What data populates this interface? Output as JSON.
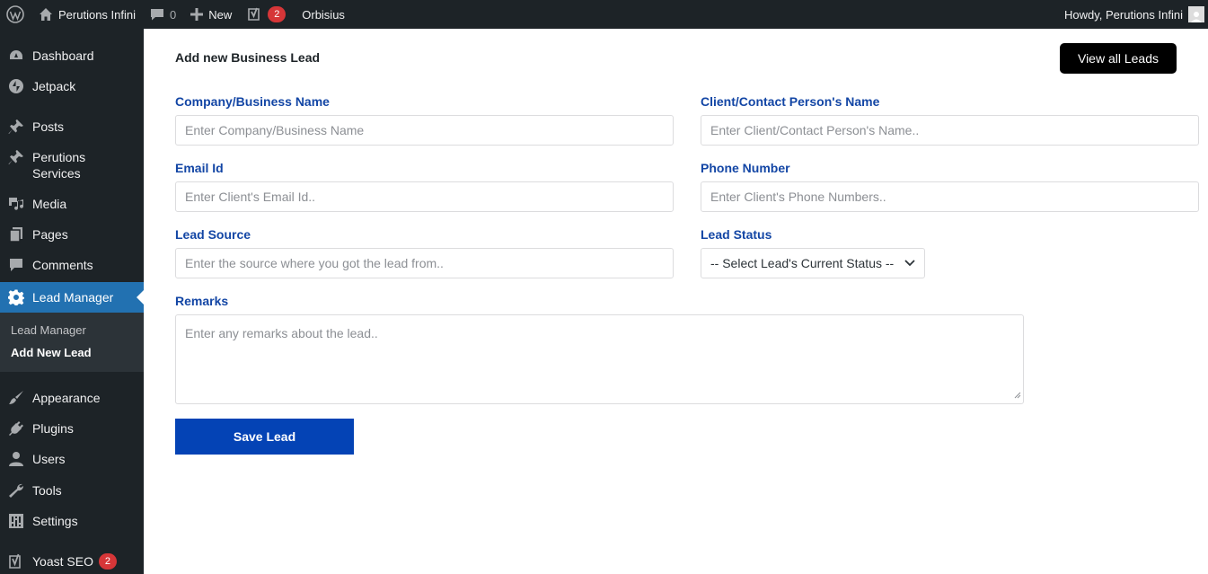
{
  "adminbar": {
    "site_name": "Perutions Infini",
    "comments_count": "0",
    "new_label": "New",
    "yoast_badge": "2",
    "site_link": "Orbisius",
    "howdy": "Howdy, Perutions Infini"
  },
  "sidebar": {
    "items": [
      {
        "label": "Dashboard",
        "icon": "dashboard-icon"
      },
      {
        "label": "Jetpack",
        "icon": "jetpack-icon"
      },
      {
        "label": "Posts",
        "icon": "pin-icon"
      },
      {
        "label": "Perutions Services",
        "icon": "pin-icon"
      },
      {
        "label": "Media",
        "icon": "media-icon"
      },
      {
        "label": "Pages",
        "icon": "pages-icon"
      },
      {
        "label": "Comments",
        "icon": "comment-icon"
      },
      {
        "label": "Lead Manager",
        "icon": "gear-icon"
      },
      {
        "label": "Appearance",
        "icon": "brush-icon"
      },
      {
        "label": "Plugins",
        "icon": "plugin-icon"
      },
      {
        "label": "Users",
        "icon": "user-icon"
      },
      {
        "label": "Tools",
        "icon": "wrench-icon"
      },
      {
        "label": "Settings",
        "icon": "settings-icon"
      },
      {
        "label": "Yoast SEO",
        "icon": "yoast-icon",
        "badge": "2"
      }
    ],
    "submenu": [
      "Lead Manager",
      "Add New Lead"
    ]
  },
  "main": {
    "title": "Add new Business Lead",
    "view_all": "View all Leads",
    "fields": {
      "company": {
        "label": "Company/Business Name",
        "placeholder": "Enter Company/Business Name"
      },
      "client": {
        "label": "Client/Contact Person's Name",
        "placeholder": "Enter Client/Contact Person's Name.."
      },
      "email": {
        "label": "Email Id",
        "placeholder": "Enter Client's Email Id.."
      },
      "phone": {
        "label": "Phone Number",
        "placeholder": "Enter Client's Phone Numbers.."
      },
      "source": {
        "label": "Lead Source",
        "placeholder": "Enter the source where you got the lead from.."
      },
      "status": {
        "label": "Lead Status",
        "selected": "-- Select Lead's Current Status --"
      },
      "remarks": {
        "label": "Remarks",
        "placeholder": "Enter any remarks about the lead.."
      }
    },
    "save": "Save Lead"
  },
  "colors": {
    "admin_bg": "#1d2327",
    "accent": "#2271b1",
    "label_blue": "#1346a5",
    "save_button": "#0443b5",
    "badge_red": "#d63638"
  }
}
